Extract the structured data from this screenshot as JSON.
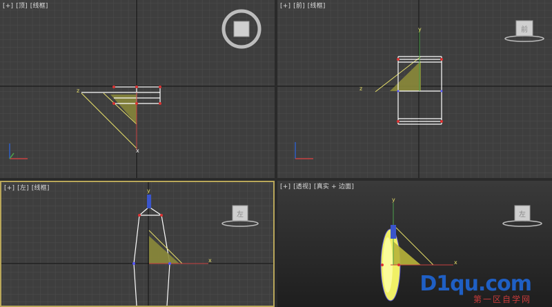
{
  "viewports": {
    "top": {
      "plus": "[+]",
      "view": "[顶]",
      "mode": "[线框]"
    },
    "front": {
      "plus": "[+]",
      "view": "[前]",
      "mode": "[线框]"
    },
    "left": {
      "plus": "[+]",
      "view": "[左]",
      "mode": "[线框]",
      "cube_face": "左"
    },
    "persp": {
      "plus": "[+]",
      "view": "[透视]",
      "mode": "[真实 + 边面]",
      "cube_face": "左"
    }
  },
  "front_cube_face": "前",
  "axes": {
    "x": "x",
    "y": "y",
    "z": "z"
  },
  "watermark": {
    "brand": "D1qu.com",
    "sub": "第一区自学网"
  },
  "colors": {
    "grid": "#4f4f4f",
    "bg": "#3d3d3d",
    "active_border": "#b9a75a",
    "yellow": "#e8e06a",
    "accent": "#2f5fc4"
  }
}
